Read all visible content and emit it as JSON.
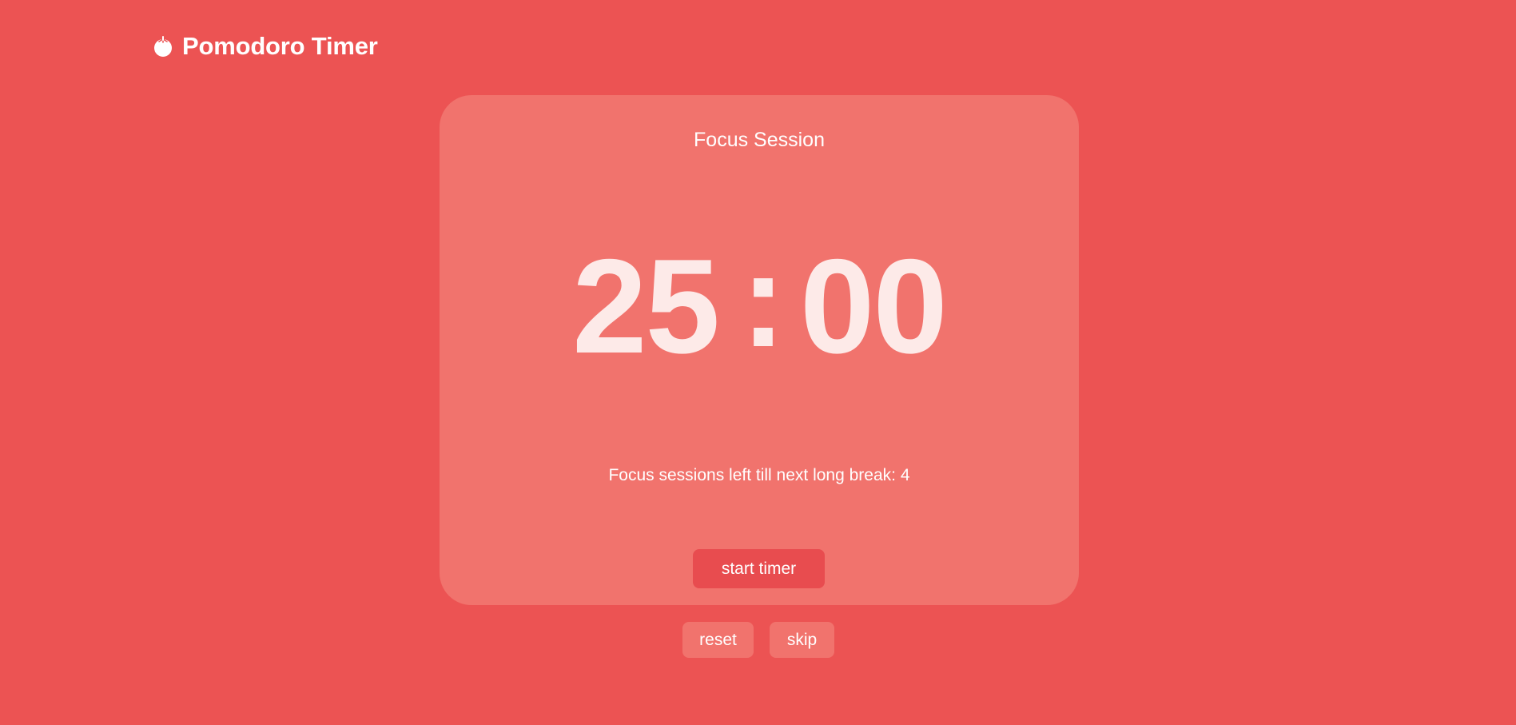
{
  "app": {
    "title": "Pomodoro Timer",
    "logo_icon": "tomato-icon"
  },
  "session": {
    "label": "Focus Session",
    "minutes": "25",
    "separator": ":",
    "seconds": "00",
    "sessions_left_text": "Focus sessions left till next long break: 4"
  },
  "actions": {
    "start_label": "start timer",
    "reset_label": "reset",
    "skip_label": "skip"
  },
  "colors": {
    "background": "#ec5353",
    "card": "#f1736d",
    "start_button": "#e84c4f",
    "timer_text": "#fdeae8",
    "text": "#ffffff"
  }
}
